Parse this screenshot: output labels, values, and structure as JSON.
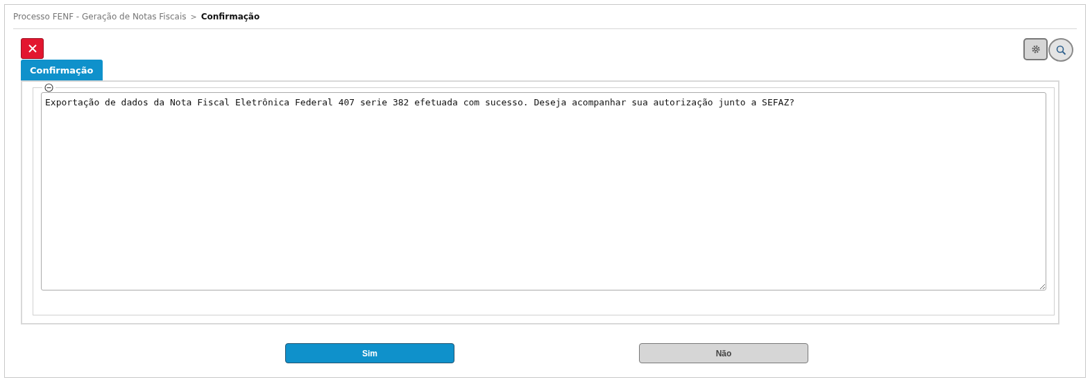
{
  "breadcrumb": {
    "items": [
      "Processo FENF - Geração de Notas Fiscais"
    ],
    "separator": ">",
    "current": "Confirmação"
  },
  "tabs": [
    {
      "label": "Confirmação",
      "selected": true
    }
  ],
  "panel": {
    "expanded": true,
    "message": "Exportação de dados da Nota Fiscal Eletrônica Federal 407 serie 382 efetuada com sucesso. Deseja acompanhar sua autorização junto a SEFAZ?"
  },
  "buttons": [
    {
      "label": "Sim",
      "kind": "primary"
    },
    {
      "label": "Não",
      "kind": "secondary"
    }
  ]
}
